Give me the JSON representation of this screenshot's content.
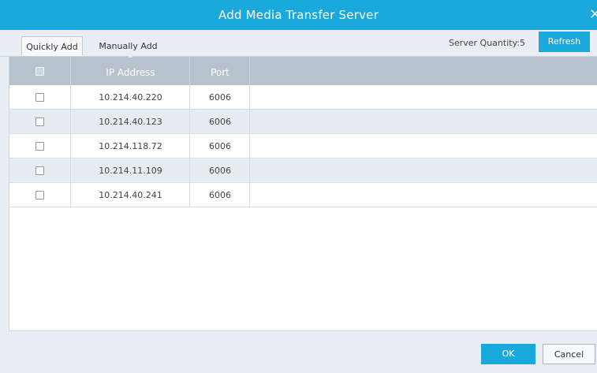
{
  "dialog": {
    "title": "Add  Media Transfer Server",
    "close_glyph": "×"
  },
  "tabs": [
    {
      "label": "Quickly Add",
      "active": true
    },
    {
      "label": "Manually Add",
      "active": false
    }
  ],
  "server_quantity": "Server Quantity:5",
  "refresh_label": "Refresh",
  "table": {
    "sort_indicator": "▲",
    "columns": [
      "",
      "IP Address",
      "Port"
    ],
    "rows": [
      {
        "ip": "10.214.40.220",
        "port": "6006",
        "checked": false
      },
      {
        "ip": "10.214.40.123",
        "port": "6006",
        "checked": false
      },
      {
        "ip": "10.214.118.72",
        "port": "6006",
        "checked": false
      },
      {
        "ip": "10.214.11.109",
        "port": "6006",
        "checked": false
      },
      {
        "ip": "10.214.40.241",
        "port": "6006",
        "checked": false
      }
    ]
  },
  "footer": {
    "ok_label": "OK",
    "cancel_label": "Cancel"
  },
  "colors": {
    "accent": "#1aa9dc",
    "header_row": "#b7c2cc",
    "alt_row": "#e6ecf1"
  }
}
